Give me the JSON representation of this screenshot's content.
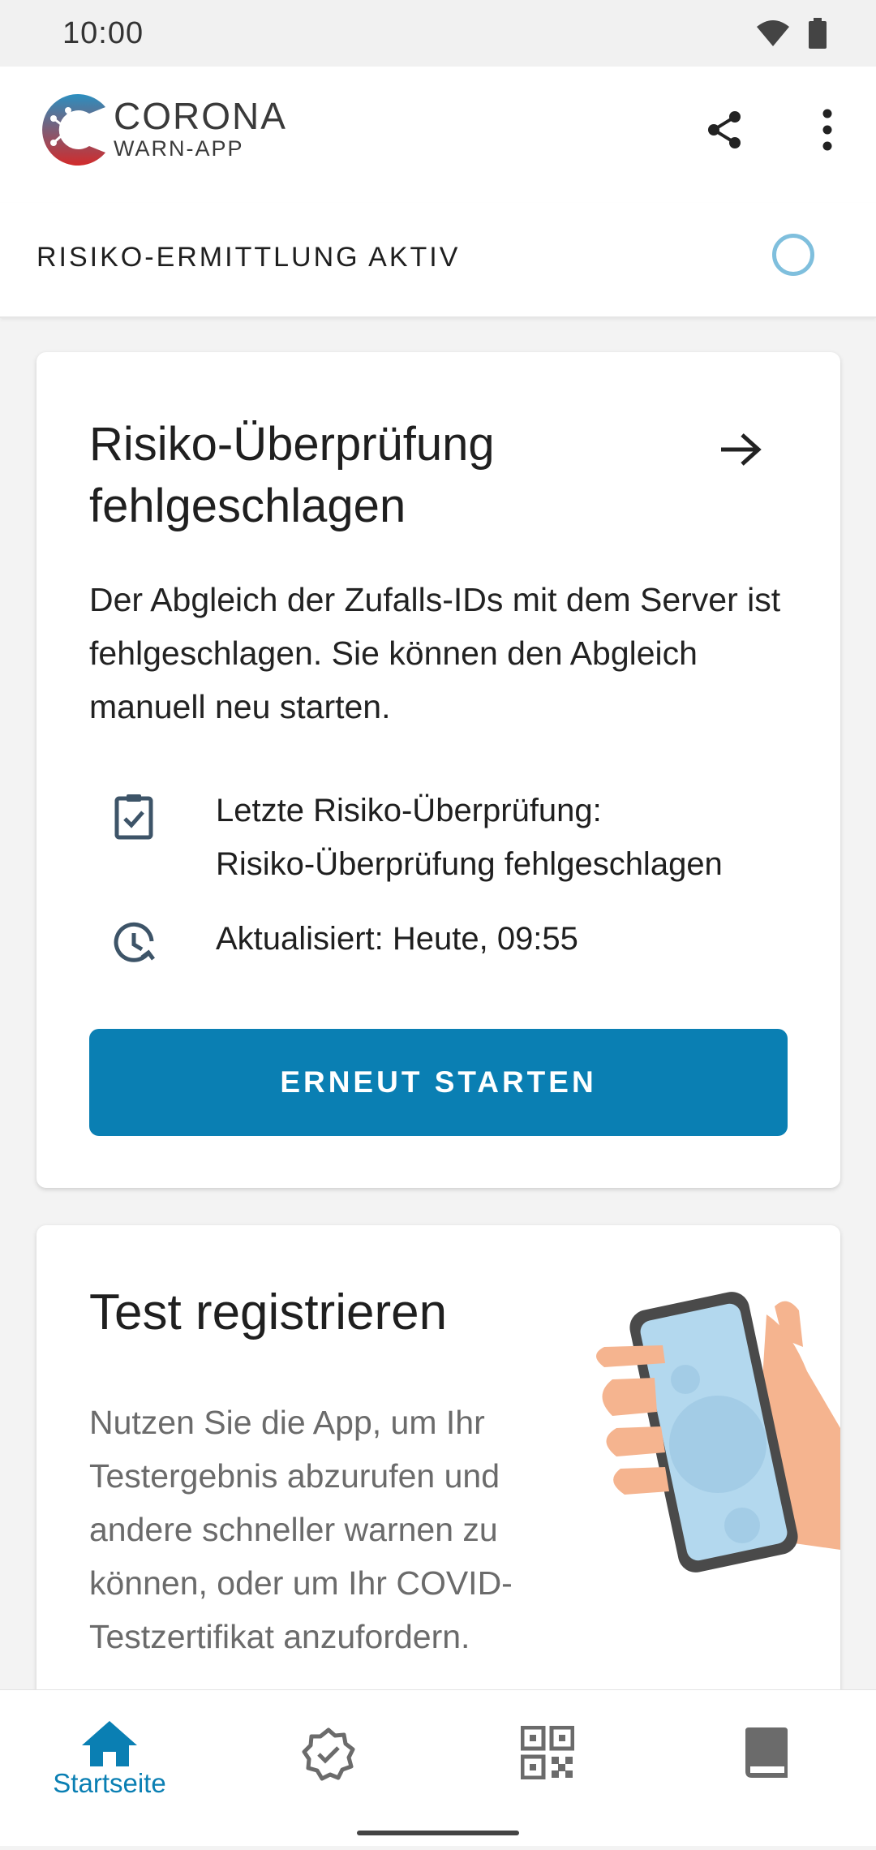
{
  "status_bar": {
    "time": "10:00"
  },
  "brand": {
    "line1": "CORONA",
    "line2": "WARN-APP"
  },
  "risk_header": {
    "label": "RISIKO-ERMITTLUNG AKTIV"
  },
  "risk_card": {
    "title": "Risiko-Überprüfung fehlgeschlagen",
    "description": "Der Abgleich der Zufalls-IDs mit dem Server ist fehlgeschlagen. Sie können den Abgleich manuell neu starten.",
    "last_check_line1": "Letzte Risiko-Überprüfung:",
    "last_check_line2": "Risiko-Überprüfung fehlgeschlagen",
    "updated": "Aktualisiert: Heute, 09:55",
    "restart_label": "ERNEUT STARTEN"
  },
  "test_card": {
    "title": "Test registrieren",
    "description": "Nutzen Sie die App, um Ihr Testergebnis abzurufen und andere schneller warnen zu können, oder um Ihr COVID-Testzertifikat anzufordern."
  },
  "bottom_nav": {
    "home_label": "Startseite",
    "items": [
      "home-icon",
      "certificate-icon",
      "qr-code-icon",
      "diary-icon"
    ]
  },
  "colors": {
    "accent": "#0a7fb3",
    "ring": "#7fbfdd"
  }
}
